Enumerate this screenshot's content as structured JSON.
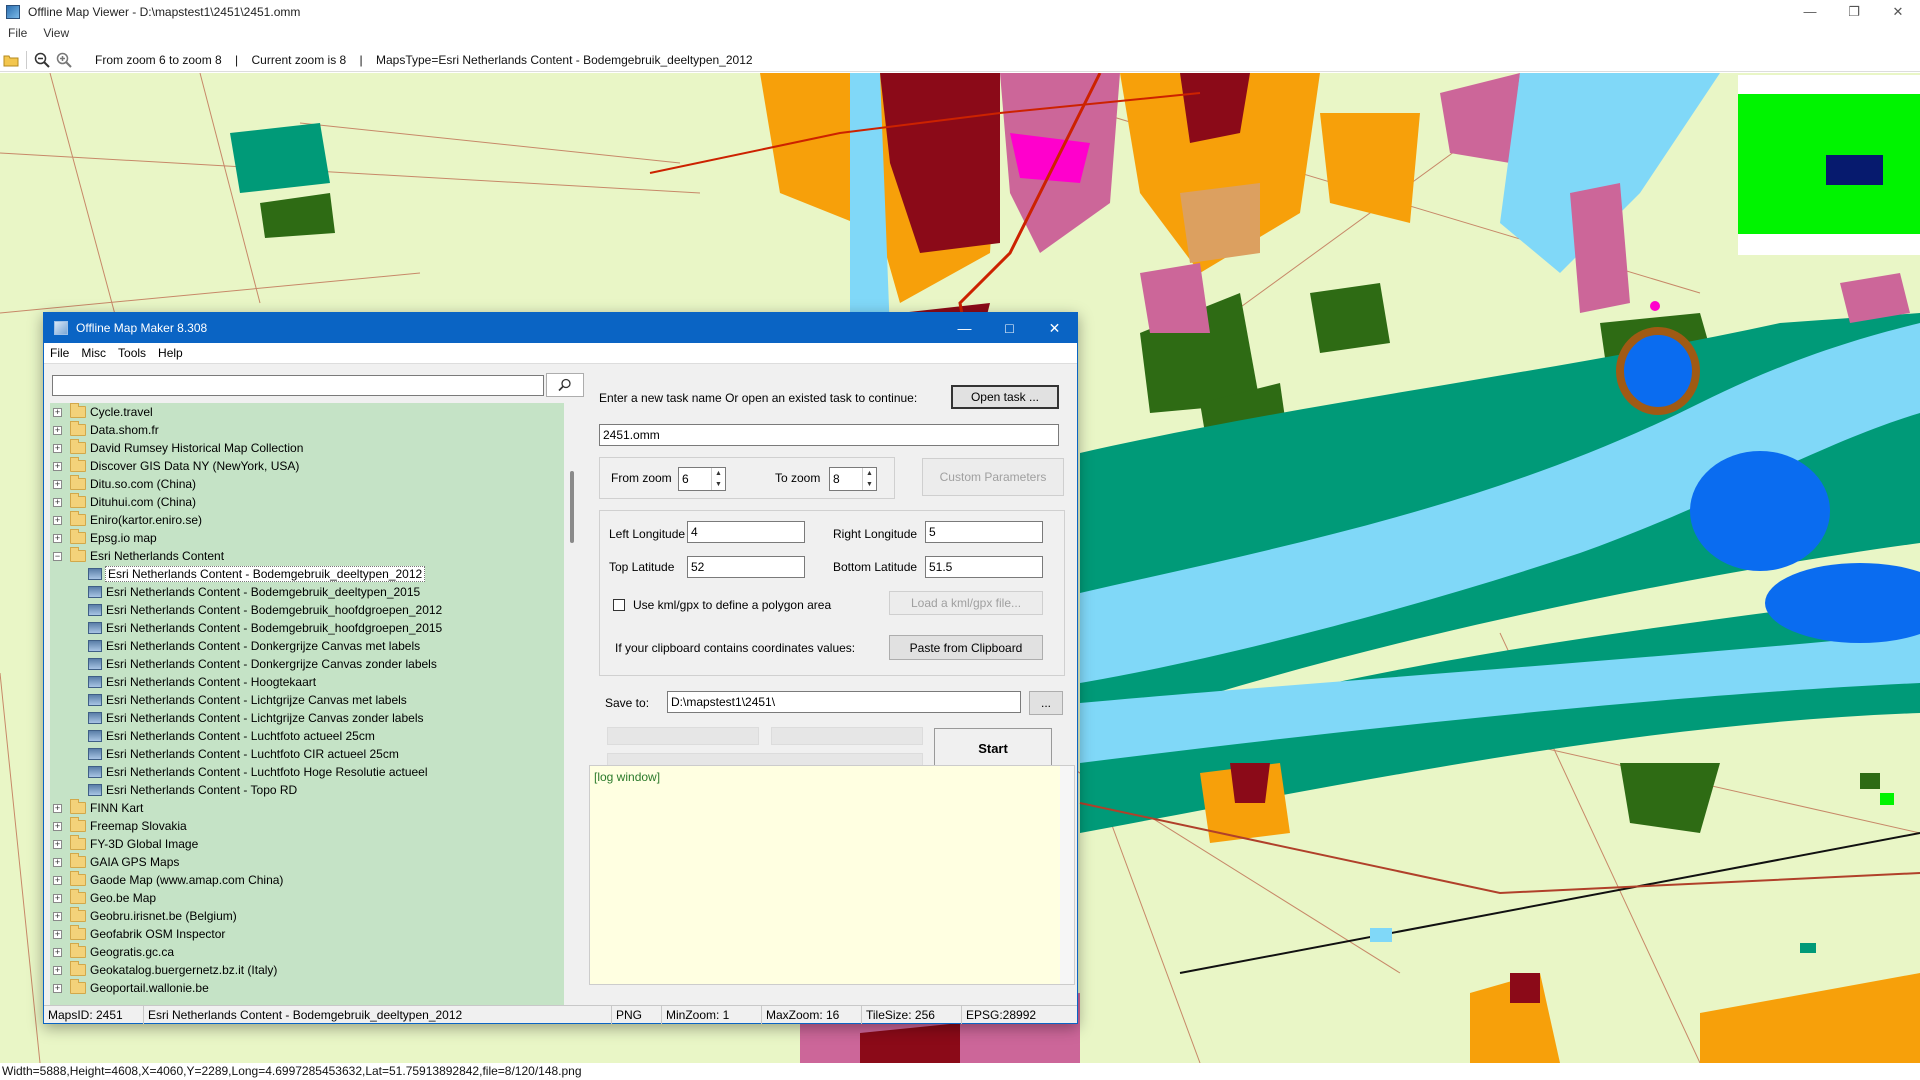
{
  "window": {
    "title": "Offline Map Viewer - D:\\mapstest1\\2451\\2451.omm",
    "menu": [
      "File",
      "View"
    ]
  },
  "toolbar": {
    "icons": [
      "open-folder-icon",
      "zoom-out-icon",
      "zoom-in-icon"
    ],
    "info": "From zoom 6 to zoom 8    |    Current zoom is 8    |    MapsType=Esri Netherlands Content - Bodemgebruik_deeltypen_2012"
  },
  "map": {
    "colors": {
      "background": "#e9f6c6",
      "water": "#80d8f8",
      "lake": "#0a6cf0",
      "teal": "#009a78",
      "darkgreen": "#2e6b14",
      "orange": "#f7a00a",
      "maroon": "#8b0a18",
      "pink": "#cc6699",
      "magenta": "#ff00cc",
      "road": "#cc2200"
    }
  },
  "overview_colors": {
    "land": "#00f400",
    "viewport": "#061a6e"
  },
  "statusbar": "Width=5888,Height=4608,X=4060,Y=2289,Long=4.6997285453632,Lat=51.75913892842,file=8/120/148.png",
  "dialog": {
    "title": "Offline Map Maker 8.308",
    "menu": [
      "File",
      "Misc",
      "Tools",
      "Help"
    ],
    "search": {
      "value": ""
    },
    "tree": [
      {
        "label": "Cycle.travel",
        "type": "folder",
        "expanded": false
      },
      {
        "label": "Data.shom.fr",
        "type": "folder",
        "expanded": false
      },
      {
        "label": "David Rumsey Historical Map Collection",
        "type": "folder",
        "expanded": false
      },
      {
        "label": "Discover GIS Data NY (NewYork, USA)",
        "type": "folder",
        "expanded": false
      },
      {
        "label": "Ditu.so.com (China)",
        "type": "folder",
        "expanded": false
      },
      {
        "label": "Dituhui.com (China)",
        "type": "folder",
        "expanded": false
      },
      {
        "label": "Eniro(kartor.eniro.se)",
        "type": "folder",
        "expanded": false
      },
      {
        "label": "Epsg.io map",
        "type": "folder",
        "expanded": false
      },
      {
        "label": "Esri Netherlands Content",
        "type": "folder",
        "expanded": true
      },
      {
        "label": "Esri Netherlands Content - Bodemgebruik_deeltypen_2012",
        "type": "map",
        "selected": true
      },
      {
        "label": "Esri Netherlands Content - Bodemgebruik_deeltypen_2015",
        "type": "map"
      },
      {
        "label": "Esri Netherlands Content - Bodemgebruik_hoofdgroepen_2012",
        "type": "map"
      },
      {
        "label": "Esri Netherlands Content - Bodemgebruik_hoofdgroepen_2015",
        "type": "map"
      },
      {
        "label": "Esri Netherlands Content - Donkergrijze Canvas met labels",
        "type": "map"
      },
      {
        "label": "Esri Netherlands Content - Donkergrijze Canvas zonder labels",
        "type": "map"
      },
      {
        "label": "Esri Netherlands Content - Hoogtekaart",
        "type": "map"
      },
      {
        "label": "Esri Netherlands Content - Lichtgrijze Canvas met labels",
        "type": "map"
      },
      {
        "label": "Esri Netherlands Content - Lichtgrijze Canvas zonder labels",
        "type": "map"
      },
      {
        "label": "Esri Netherlands Content - Luchtfoto actueel 25cm",
        "type": "map"
      },
      {
        "label": "Esri Netherlands Content - Luchtfoto CIR actueel 25cm",
        "type": "map"
      },
      {
        "label": "Esri Netherlands Content - Luchtfoto Hoge Resolutie actueel",
        "type": "map"
      },
      {
        "label": "Esri Netherlands Content - Topo RD",
        "type": "map"
      },
      {
        "label": "FINN Kart",
        "type": "folder",
        "expanded": false
      },
      {
        "label": "Freemap Slovakia",
        "type": "folder",
        "expanded": false
      },
      {
        "label": "FY-3D Global Image",
        "type": "folder",
        "expanded": false
      },
      {
        "label": "GAIA GPS Maps",
        "type": "folder",
        "expanded": false
      },
      {
        "label": "Gaode Map (www.amap.com China)",
        "type": "folder",
        "expanded": false
      },
      {
        "label": "Geo.be Map",
        "type": "folder",
        "expanded": false
      },
      {
        "label": "Geobru.irisnet.be (Belgium)",
        "type": "folder",
        "expanded": false
      },
      {
        "label": "Geofabrik OSM Inspector",
        "type": "folder",
        "expanded": false
      },
      {
        "label": "Geogratis.gc.ca",
        "type": "folder",
        "expanded": false
      },
      {
        "label": "Geokatalog.buergernetz.bz.it (Italy)",
        "type": "folder",
        "expanded": false
      },
      {
        "label": "Geoportail.wallonie.be",
        "type": "folder",
        "expanded": false
      }
    ],
    "task_prompt": "Enter a new task name Or open an existed task to continue:",
    "open_task_button": "Open task ...",
    "task_name": "2451.omm",
    "from_zoom_label": "From zoom",
    "from_zoom": "6",
    "to_zoom_label": "To zoom",
    "to_zoom": "8",
    "custom_params_button": "Custom Parameters",
    "left_lon_label": "Left Longitude",
    "left_lon": "4",
    "right_lon_label": "Right Longitude",
    "right_lon": "5",
    "top_lat_label": "Top Latitude",
    "top_lat": "52",
    "bottom_lat_label": "Bottom Latitude",
    "bottom_lat": "51.5",
    "kml_checkbox_label": "Use kml/gpx to define a polygon area",
    "load_kml_button": "Load a kml/gpx file...",
    "clipboard_label": "If your clipboard contains coordinates values:",
    "paste_button": "Paste from Clipboard",
    "save_to_label": "Save to:",
    "save_to": "D:\\mapstest1\\2451\\",
    "browse_button": "...",
    "start_button": "Start",
    "log_text": "[log window]",
    "status": {
      "maps_id": "MapsID: 2451",
      "map_name": "Esri Netherlands Content - Bodemgebruik_deeltypen_2012",
      "format": "PNG",
      "min_zoom": "MinZoom: 1",
      "max_zoom": "MaxZoom: 16",
      "tile_size": "TileSize: 256",
      "epsg": "EPSG:28992"
    }
  }
}
